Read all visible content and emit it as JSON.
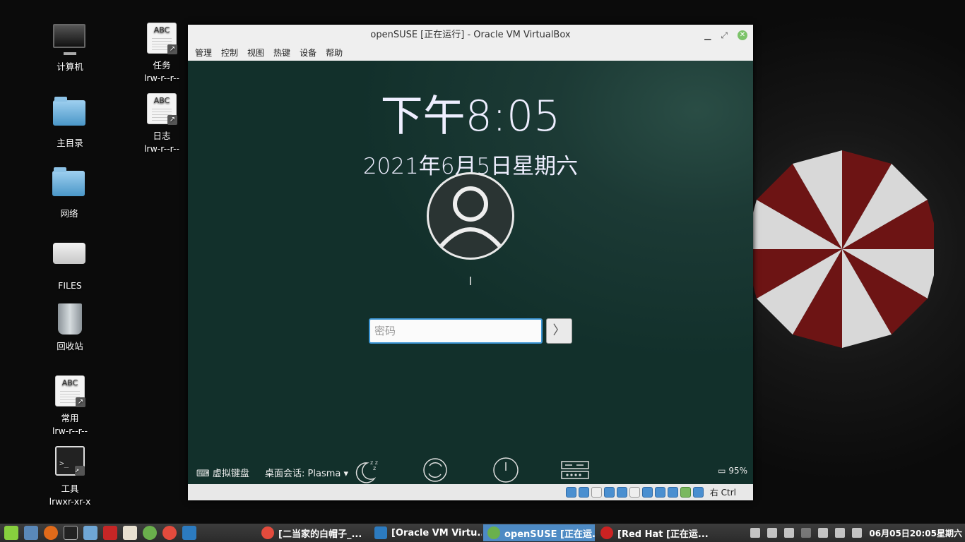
{
  "desktop": {
    "icons": [
      {
        "label": "计算机",
        "sub": ""
      },
      {
        "label": "主目录",
        "sub": ""
      },
      {
        "label": "网络",
        "sub": ""
      },
      {
        "label": "FILES",
        "sub": ""
      },
      {
        "label": "回收站",
        "sub": ""
      },
      {
        "label": "常用",
        "sub": "lrw-r--r--"
      },
      {
        "label": "工具",
        "sub": "lrwxr-xr-x"
      },
      {
        "label": "任务",
        "sub": "lrw-r--r--"
      },
      {
        "label": "日志",
        "sub": "lrw-r--r--"
      }
    ],
    "doc_icon_text": "ABC"
  },
  "vm_window": {
    "title": "openSUSE [正在运行] - Oracle VM VirtualBox",
    "menu": [
      "管理",
      "控制",
      "视图",
      "热键",
      "设备",
      "帮助"
    ],
    "host_key": "右 Ctrl"
  },
  "login": {
    "time": "下午8:05",
    "date": "2021年6月5日星期六",
    "username": "l",
    "password_placeholder": "密码",
    "virtual_keyboard": "虚拟键盘",
    "session_label": "桌面会话:",
    "session_value": "Plasma",
    "battery": "95%"
  },
  "taskbar": {
    "tasks": [
      {
        "label": "[二当家的白帽子_...",
        "color": "#e34b3d",
        "active": false
      },
      {
        "label": "[Oracle VM Virtu...",
        "color": "#2c7bc0",
        "active": false
      },
      {
        "label": "openSUSE [正在运...",
        "color": "#6ab04c",
        "active": true
      },
      {
        "label": "[Red Hat [正在运...",
        "color": "#cc2222",
        "active": false
      }
    ],
    "clock": "06月05日20:05星期六"
  }
}
